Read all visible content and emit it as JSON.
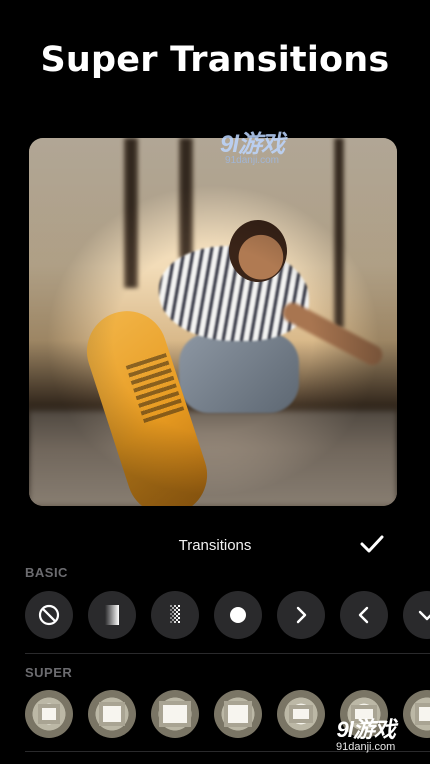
{
  "headline": "Super Transitions",
  "watermark": {
    "logo": "9l游戏",
    "url": "91danji.com"
  },
  "panel": {
    "title": "Transitions",
    "confirm_icon": "checkmark-icon"
  },
  "sections": {
    "basic_label": "BASIC",
    "super_label": "SUPER"
  },
  "basic_transitions": [
    {
      "icon": "none-icon"
    },
    {
      "icon": "fade-gradient-icon"
    },
    {
      "icon": "dissolve-icon"
    },
    {
      "icon": "circle-icon"
    },
    {
      "icon": "chevron-right-icon"
    },
    {
      "icon": "chevron-left-icon"
    },
    {
      "icon": "chevron-down-icon"
    }
  ],
  "super_transitions": [
    {
      "icon": "zoom-blur-thumbnail"
    },
    {
      "icon": "zoom-blur-thumbnail"
    },
    {
      "icon": "zoom-blur-thumbnail"
    },
    {
      "icon": "zoom-blur-thumbnail"
    },
    {
      "icon": "zoom-blur-thumbnail"
    },
    {
      "icon": "zoom-blur-thumbnail"
    },
    {
      "icon": "zoom-blur-thumbnail"
    }
  ],
  "colors": {
    "background": "#000000",
    "button_fill": "#2a2a2c",
    "section_label": "#6c6c70",
    "divider": "#2a2a2c"
  }
}
